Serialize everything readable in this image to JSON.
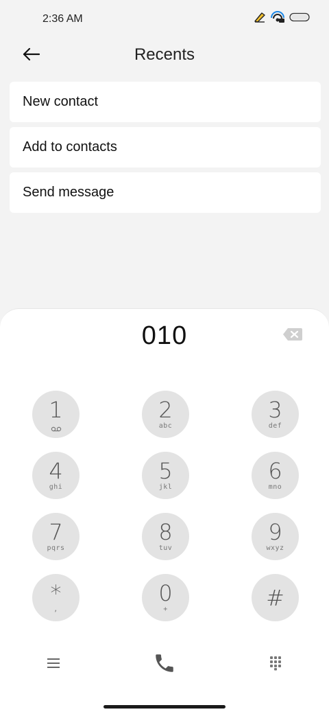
{
  "status_bar": {
    "time": "2:36 AM",
    "icons": [
      "pen-notification-icon",
      "hotspot-icon",
      "battery-icon"
    ]
  },
  "header": {
    "back_icon": "arrow-left-icon",
    "title": "Recents"
  },
  "menu": [
    {
      "label": "New contact"
    },
    {
      "label": "Add to contacts"
    },
    {
      "label": "Send message"
    }
  ],
  "dialer": {
    "number": "010",
    "backspace_icon": "backspace-icon",
    "keys": [
      {
        "digit": "1",
        "sub": ""
      },
      {
        "digit": "2",
        "sub": "abc"
      },
      {
        "digit": "3",
        "sub": "def"
      },
      {
        "digit": "4",
        "sub": "ghi"
      },
      {
        "digit": "5",
        "sub": "jkl"
      },
      {
        "digit": "6",
        "sub": "mno"
      },
      {
        "digit": "7",
        "sub": "pqrs"
      },
      {
        "digit": "8",
        "sub": "tuv"
      },
      {
        "digit": "9",
        "sub": "wxyz"
      },
      {
        "digit": "*",
        "sub": ","
      },
      {
        "digit": "0",
        "sub": "+"
      },
      {
        "digit": "#",
        "sub": ""
      }
    ]
  },
  "bottom_bar": {
    "menu_icon": "hamburger-menu-icon",
    "call_icon": "phone-icon",
    "keypad_icon": "keypad-grid-icon"
  },
  "colors": {
    "background": "#f3f3f3",
    "card": "#ffffff",
    "key": "#e3e3e3",
    "call": "#555555"
  }
}
